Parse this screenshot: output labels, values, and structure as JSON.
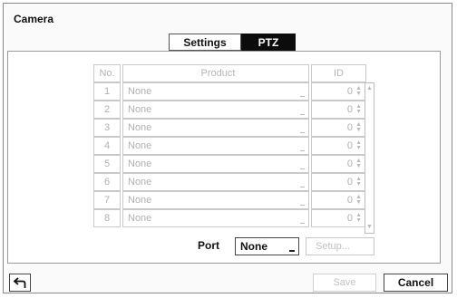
{
  "window": {
    "title": "Camera"
  },
  "tabs": [
    {
      "label": "Settings"
    },
    {
      "label": "PTZ"
    }
  ],
  "table": {
    "headers": {
      "no": "No.",
      "product": "Product",
      "id": "ID"
    },
    "rows": [
      {
        "no": "1",
        "product": "None",
        "id": "0"
      },
      {
        "no": "2",
        "product": "None",
        "id": "0"
      },
      {
        "no": "3",
        "product": "None",
        "id": "0"
      },
      {
        "no": "4",
        "product": "None",
        "id": "0"
      },
      {
        "no": "5",
        "product": "None",
        "id": "0"
      },
      {
        "no": "6",
        "product": "None",
        "id": "0"
      },
      {
        "no": "7",
        "product": "None",
        "id": "0"
      },
      {
        "no": "8",
        "product": "None",
        "id": "0"
      }
    ]
  },
  "port": {
    "label": "Port",
    "value": "None"
  },
  "setup_button": {
    "label": "Setup..."
  },
  "footer": {
    "save_label": "Save",
    "cancel_label": "Cancel",
    "back_icon": "back-arrow-icon"
  }
}
